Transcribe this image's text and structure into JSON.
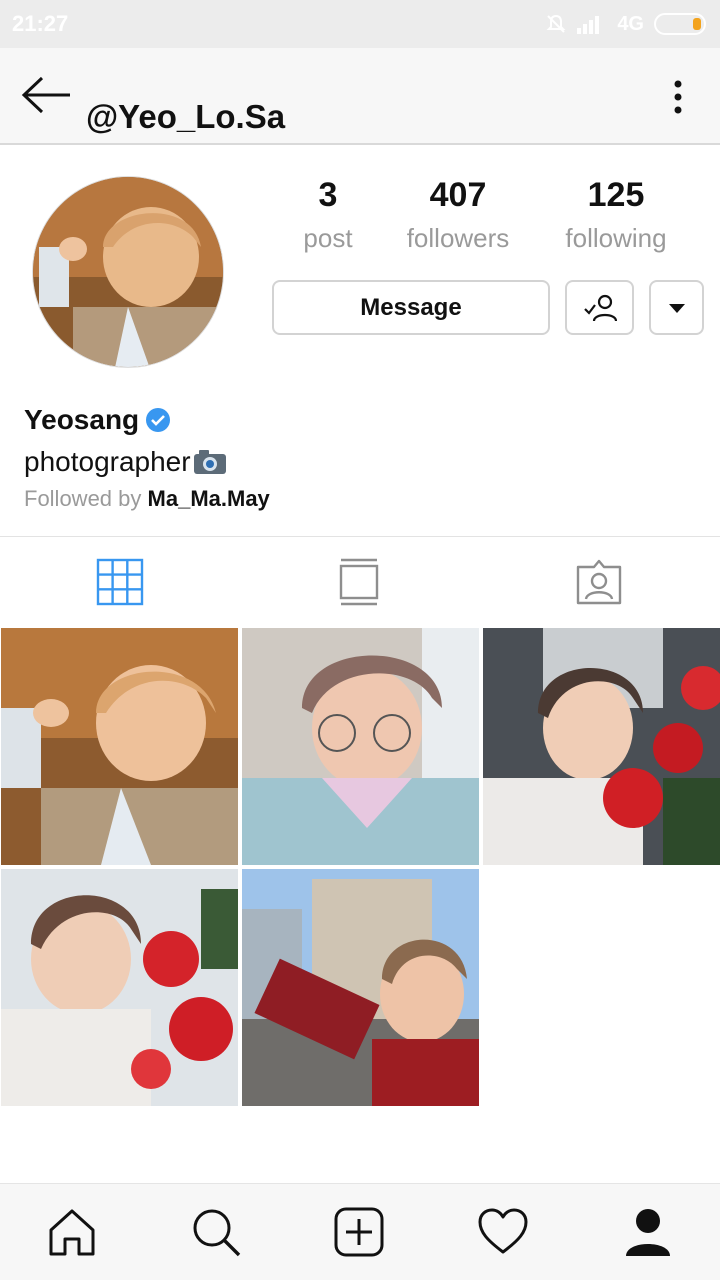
{
  "status_bar": {
    "time": "21:27",
    "network": "4G"
  },
  "header": {
    "username": "@Yeo_Lo.Sa"
  },
  "profile": {
    "stats": [
      {
        "value": "3",
        "label": "post"
      },
      {
        "value": "407",
        "label": "followers"
      },
      {
        "value": "125",
        "label": "following"
      }
    ],
    "message_label": "Message",
    "display_name": "Yeosang",
    "bio": "photographer",
    "followed_by_prefix": "Followed by",
    "followed_by_user": "Ma_Ma.May"
  },
  "tabs": [
    "grid-icon",
    "feed-icon",
    "tagged-icon"
  ],
  "colors": {
    "accent": "#3897f0",
    "verified": "#3897f0",
    "battery": "#f3a31d"
  },
  "bottom_nav": [
    "home-icon",
    "search-icon",
    "add-post-icon",
    "heart-icon",
    "profile-icon"
  ]
}
